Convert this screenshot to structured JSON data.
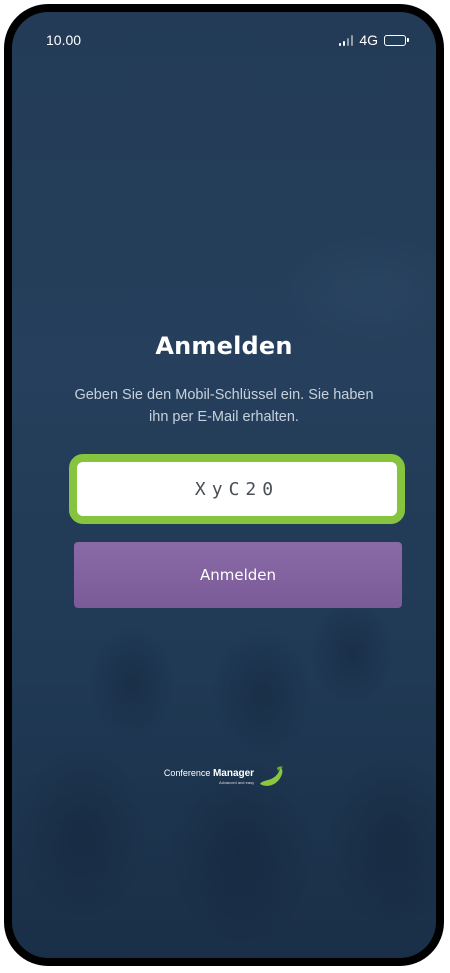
{
  "status_bar": {
    "time": "10.00",
    "network": "4G",
    "icons": [
      "signal-icon",
      "battery-icon"
    ]
  },
  "login": {
    "title": "Anmelden",
    "subtitle": "Geben Sie den Mobil-Schlüssel ein. Sie haben ihn per E-Mail erhalten.",
    "key_value": "XyC20",
    "button_label": "Anmelden"
  },
  "branding": {
    "prefix": "Conference",
    "name": "Manager",
    "tagline": "Advanced and easy",
    "icon": "leaf-logo-icon"
  },
  "colors": {
    "background": "#233b56",
    "input_highlight": "#86c440",
    "button": "#7f5f9e",
    "logo_leaf": "#8cc63f"
  }
}
